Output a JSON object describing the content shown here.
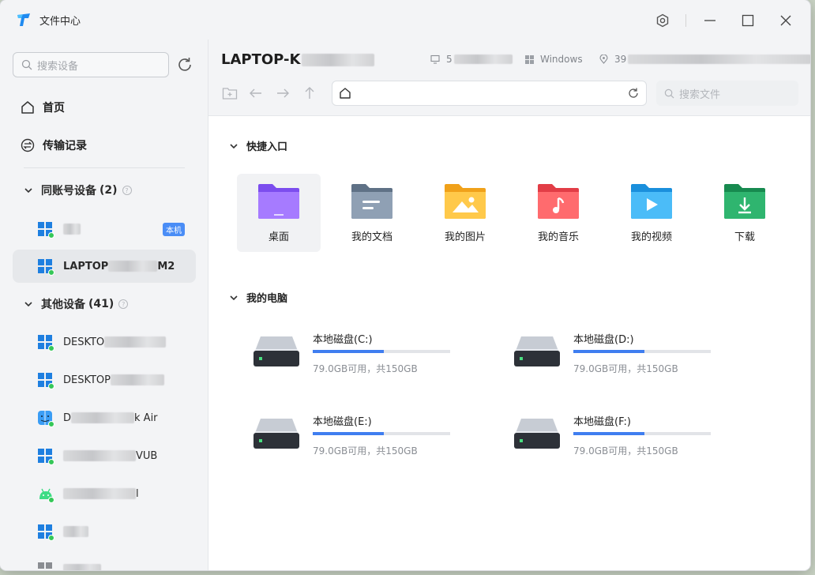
{
  "app": {
    "title": "文件中心",
    "accent": "#3f7ef0"
  },
  "window_controls": [
    "settings-icon",
    "minimize-icon",
    "maximize-icon",
    "close-icon"
  ],
  "sidebar": {
    "search_placeholder": "搜索设备",
    "nav": [
      {
        "label": "首页",
        "icon": "home-icon"
      },
      {
        "label": "传输记录",
        "icon": "transfer-icon"
      }
    ],
    "groups": [
      {
        "label": "同账号设备",
        "count": "(2)",
        "devices": [
          {
            "name": "",
            "os": "windows",
            "badge": "本机",
            "active": false
          },
          {
            "name": "LAPTOP",
            "name_suffix": "M2",
            "os": "windows",
            "active": true
          }
        ]
      },
      {
        "label": "其他设备",
        "count": "(41)",
        "devices": [
          {
            "name": "DESKTO",
            "os": "windows"
          },
          {
            "name": "DESKTOP",
            "os": "windows"
          },
          {
            "name": "D",
            "name_suffix": "k Air",
            "os": "mac"
          },
          {
            "name": "",
            "name_suffix": "VUB",
            "os": "windows"
          },
          {
            "name": "",
            "name_suffix": "l",
            "os": "android"
          },
          {
            "name": "",
            "os": "windows"
          },
          {
            "name": "",
            "os": "windows"
          }
        ]
      }
    ]
  },
  "main": {
    "device_title": "LAPTOP-K",
    "meta": {
      "ip_prefix": "5",
      "os": "Windows",
      "location_prefix": "39"
    },
    "search_placeholder": "搜索文件",
    "quick_section": "快捷入口",
    "quick": [
      {
        "label": "桌面",
        "icon": "desktop-folder-icon",
        "color": "#8b5cf6"
      },
      {
        "label": "我的文档",
        "icon": "documents-folder-icon",
        "color": "#7d8ea3"
      },
      {
        "label": "我的图片",
        "icon": "pictures-folder-icon",
        "color": "#f7b731"
      },
      {
        "label": "我的音乐",
        "icon": "music-folder-icon",
        "color": "#ef5a5a"
      },
      {
        "label": "我的视频",
        "icon": "videos-folder-icon",
        "color": "#2fa9f0"
      },
      {
        "label": "下载",
        "icon": "downloads-folder-icon",
        "color": "#22a361"
      }
    ],
    "computer_section": "我的电脑",
    "disks": [
      {
        "label": "本地磁盘(C:)",
        "info": "79.0GB可用，共150GB",
        "used_fraction": 0.52
      },
      {
        "label": "本地磁盘(D:)",
        "info": "79.0GB可用，共150GB",
        "used_fraction": 0.52
      },
      {
        "label": "本地磁盘(E:)",
        "info": "79.0GB可用，共150GB",
        "used_fraction": 0.52
      },
      {
        "label": "本地磁盘(F:)",
        "info": "79.0GB可用，共150GB",
        "used_fraction": 0.52
      }
    ]
  }
}
